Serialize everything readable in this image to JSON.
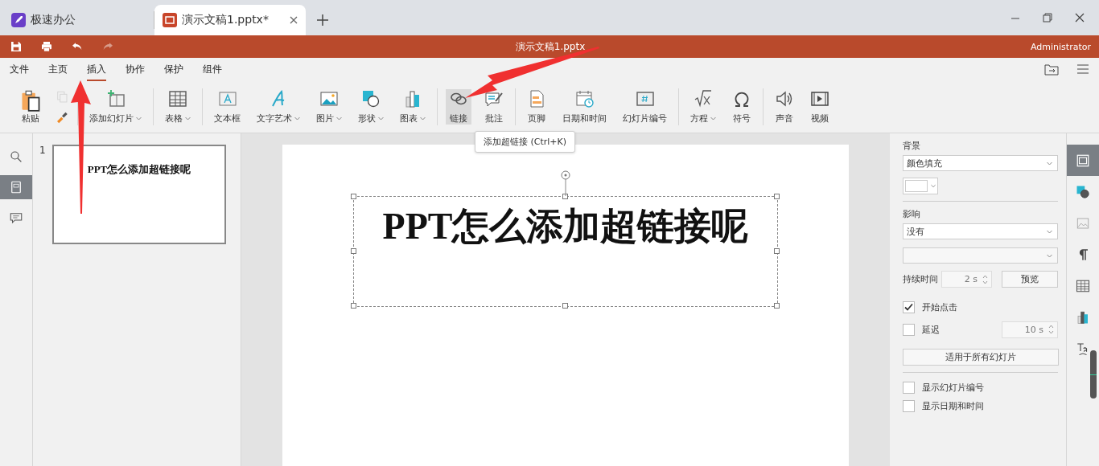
{
  "browser_tabs": [
    {
      "label": "极速办公",
      "kind": "app",
      "selected": false
    },
    {
      "label": "演示文稿1.pptx*",
      "kind": "doc",
      "selected": true
    }
  ],
  "title_bar": {
    "title": "演示文稿1.pptx",
    "user": "Administrator"
  },
  "quick_tools": [
    {
      "kind": "save",
      "disabled": false
    },
    {
      "kind": "print",
      "disabled": false
    },
    {
      "kind": "undo",
      "disabled": false
    },
    {
      "kind": "redo",
      "disabled": true
    }
  ],
  "menu": [
    {
      "label": "文件",
      "selected": false
    },
    {
      "label": "主页",
      "selected": false
    },
    {
      "label": "插入",
      "selected": true
    },
    {
      "label": "协作",
      "selected": false
    },
    {
      "label": "保护",
      "selected": false
    },
    {
      "label": "组件",
      "selected": false
    }
  ],
  "toolbar": {
    "groups": [
      [
        {
          "kind": "paste",
          "label": "粘贴",
          "dropdown": false,
          "selected": false,
          "disabled": false
        },
        {
          "kind": "copy",
          "disabled": true
        },
        {
          "kind": "painter",
          "disabled": false
        }
      ],
      [
        {
          "kind": "add-slide",
          "label": "添加幻灯片",
          "dropdown": true,
          "selected": false,
          "disabled": false
        }
      ],
      [
        {
          "kind": "table",
          "label": "表格",
          "dropdown": true,
          "selected": false,
          "disabled": false
        }
      ],
      [
        {
          "kind": "textbox",
          "label": "文本框",
          "dropdown": false,
          "selected": false,
          "disabled": false
        },
        {
          "kind": "wordart",
          "label": "文字艺术",
          "dropdown": true,
          "selected": false,
          "disabled": false
        },
        {
          "kind": "picture",
          "label": "图片",
          "dropdown": true,
          "selected": false,
          "disabled": false
        },
        {
          "kind": "shape",
          "label": "形状",
          "dropdown": true,
          "selected": false,
          "disabled": false
        },
        {
          "kind": "chart",
          "label": "图表",
          "dropdown": true,
          "selected": false,
          "disabled": false
        }
      ],
      [
        {
          "kind": "link",
          "label": "链接",
          "dropdown": false,
          "selected": true,
          "disabled": false
        },
        {
          "kind": "comment",
          "label": "批注",
          "dropdown": false,
          "selected": false,
          "disabled": false
        }
      ],
      [
        {
          "kind": "footer",
          "label": "页脚",
          "dropdown": false,
          "selected": false,
          "disabled": false
        },
        {
          "kind": "datetime",
          "label": "日期和时间",
          "dropdown": false,
          "selected": false,
          "disabled": false
        },
        {
          "kind": "slide-number",
          "label": "幻灯片编号",
          "dropdown": false,
          "selected": false,
          "disabled": false
        }
      ],
      [
        {
          "kind": "equation",
          "label": "方程",
          "dropdown": true,
          "selected": false,
          "disabled": false
        },
        {
          "kind": "symbol",
          "label": "符号",
          "dropdown": false,
          "selected": false,
          "disabled": false
        }
      ],
      [
        {
          "kind": "audio",
          "label": "声音",
          "dropdown": false,
          "selected": false,
          "disabled": false
        },
        {
          "kind": "video",
          "label": "视频",
          "dropdown": false,
          "selected": false,
          "disabled": false
        }
      ]
    ]
  },
  "tooltip": "添加超链接 (Ctrl+K)",
  "left_tools": [
    {
      "kind": "search",
      "selected": false
    },
    {
      "kind": "slides",
      "selected": true
    },
    {
      "kind": "comments",
      "selected": false
    }
  ],
  "slides": [
    {
      "number": "1",
      "title": "PPT怎么添加超链接呢",
      "selected": true
    }
  ],
  "slide_title": "PPT怎么添加超链接呢",
  "panel": {
    "background_label": "背景",
    "fill_select": "颜色填充",
    "effect_label": "影响",
    "effect_select": "没有",
    "duration_label": "持续时间",
    "duration": "2 s",
    "preview_button": "预览",
    "checks": [
      {
        "label": "开始点击",
        "checked": true
      },
      {
        "label": "延迟",
        "checked": false,
        "value": "10 s"
      }
    ],
    "apply_button": "适用于所有幻灯片",
    "options": [
      {
        "label": "显示幻灯片编号",
        "checked": false
      },
      {
        "label": "显示日期和时间",
        "checked": false
      }
    ]
  },
  "right_tools": [
    {
      "kind": "slide-settings",
      "selected": true
    },
    {
      "kind": "shape",
      "selected": false
    },
    {
      "kind": "image",
      "selected": false
    },
    {
      "kind": "paragraph",
      "selected": false
    },
    {
      "kind": "table",
      "selected": false
    },
    {
      "kind": "chart",
      "selected": false
    },
    {
      "kind": "text-art",
      "selected": false
    }
  ]
}
